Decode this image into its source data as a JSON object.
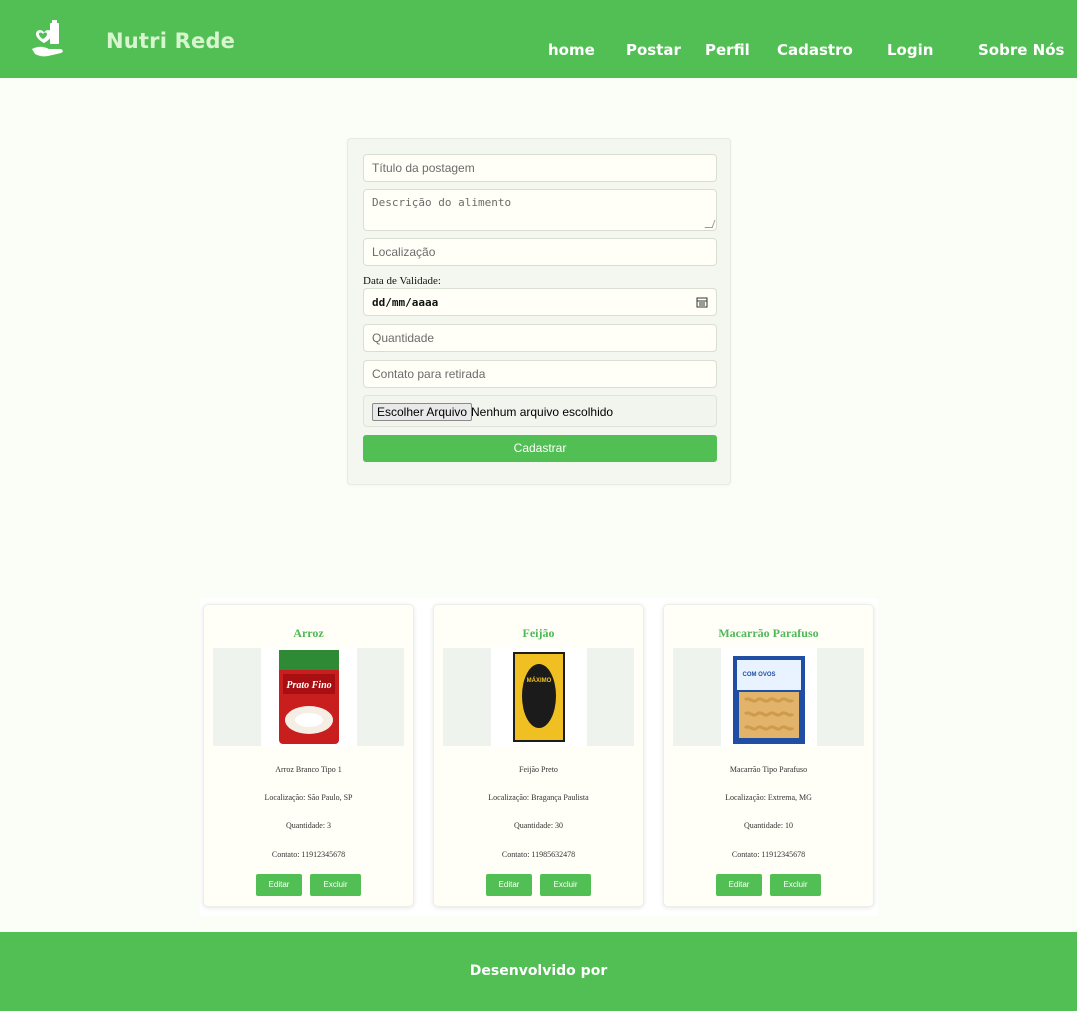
{
  "header": {
    "brand": "Nutri Rede",
    "nav": [
      "home",
      "Postar",
      "Perfil",
      "Cadastro",
      "Login",
      "Sobre Nós"
    ]
  },
  "form": {
    "title_placeholder": "Título da postagem",
    "description_placeholder": "Descrição do alimento",
    "location_placeholder": "Localização",
    "date_label": "Data de Validade:",
    "date_value": "dd/mm/aaaa",
    "quantity_placeholder": "Quantidade",
    "contact_placeholder": "Contato para retirada",
    "file_button": "Escolher Arquivo",
    "file_status": "Nenhum arquivo escolhido",
    "submit": "Cadastrar"
  },
  "cards": [
    {
      "title": "Arroz",
      "description": "Arroz Branco Tipo 1",
      "location": "Localização: São Paulo, SP",
      "quantity": "Quantidade: 3",
      "contact": "Contato: 11912345678",
      "image_text": "Prato Fino",
      "edit": "Editar",
      "delete": "Excluir"
    },
    {
      "title": "Feijão",
      "description": "Feijão Preto",
      "location": "Localização: Bragança Paulista",
      "quantity": "Quantidade: 30",
      "contact": "Contato: 11985632478",
      "image_text": "MÁXIMO",
      "edit": "Editar",
      "delete": "Excluir"
    },
    {
      "title": "Macarrão Parafuso",
      "description": "Macarrão Tipo Parafuso",
      "location": "Localização: Extrema, MG",
      "quantity": "Quantidade: 10",
      "contact": "Contato: 11912345678",
      "image_text": "COM OVOS",
      "edit": "Editar",
      "delete": "Excluir"
    }
  ],
  "footer": {
    "text": "Desenvolvido por"
  },
  "colors": {
    "accent": "#52bf54",
    "brand_text": "#d7f5cf",
    "card_title": "#4fb857"
  },
  "icons": [
    "food-donation-logo-icon",
    "calendar-icon",
    "resize-grip-icon"
  ]
}
